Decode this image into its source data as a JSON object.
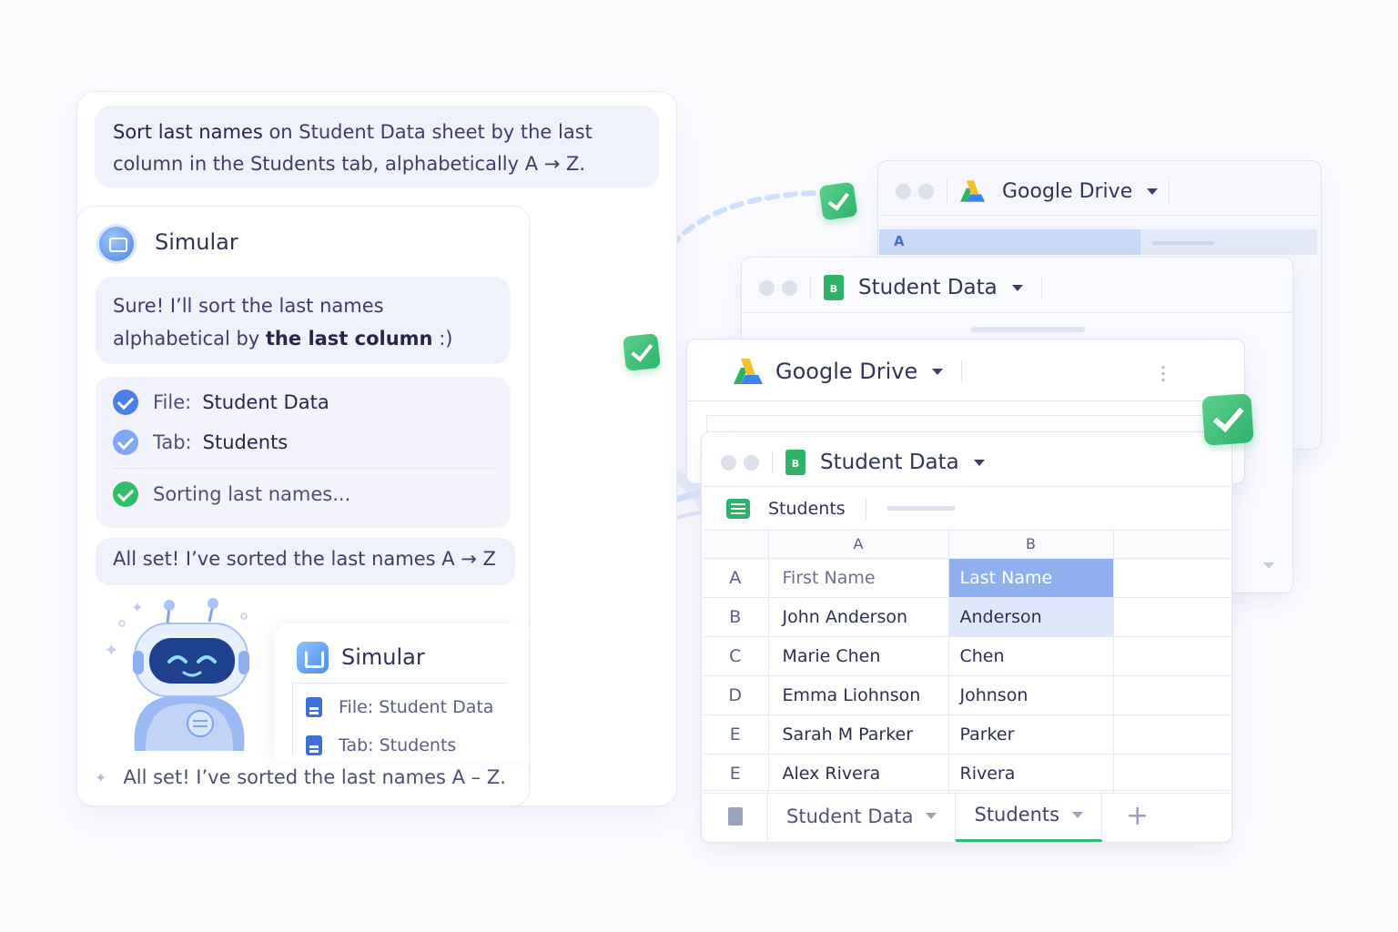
{
  "chat": {
    "prompt_bold": "Sort last names",
    "prompt_rest_1": " on Student Data sheet by the last",
    "prompt_line2": "column in the Students tab, alphabetically A → Z.",
    "agent_name": "Simular",
    "reply_line1_pre": "Sure! I’ll sort ",
    "reply_line1_bold": "the last names",
    "reply_line2_pre": "alphabetical by ",
    "reply_line2_mid": "the ",
    "reply_line2_bold": "last column",
    "reply_line2_post": " :)",
    "steps": [
      {
        "label": "File:",
        "value": "Student Data"
      },
      {
        "label": "Tab:",
        "value": "Students"
      },
      {
        "label": "Sorting last names...",
        "value": ""
      }
    ],
    "done_message": "All set! I’ve sorted the last names A → Z",
    "mini_card": {
      "name": "Simular",
      "file": "File: Student Data",
      "tab": "Tab: Students"
    },
    "footer_message": "All set! I’ve sorted the last names A – Z."
  },
  "windows": {
    "back_drive_title": "Google Drive",
    "back_col_label": "A",
    "back_sheet_title": "Student Data",
    "mid_drive_title": "Google Drive",
    "front_sheet_title": "Student Data",
    "front_sheet_badge": "B",
    "tab_name": "Students"
  },
  "sheet": {
    "col_headers": [
      "A",
      "B"
    ],
    "rows": [
      {
        "row": "A",
        "first": "First Name",
        "last": "Last Name"
      },
      {
        "row": "B",
        "first": "John Anderson",
        "last": "Anderson"
      },
      {
        "row": "C",
        "first": "Marie Chen",
        "last": "Chen"
      },
      {
        "row": "D",
        "first": "Emma Liohnson",
        "last": "Johnson"
      },
      {
        "row": "E",
        "first": "Sarah M Parker",
        "last": "Parker"
      },
      {
        "row": "E",
        "first": "Alex Rivera",
        "last": "Rivera"
      }
    ],
    "tabs": [
      "Student Data",
      "Students"
    ],
    "add_tab": "+"
  },
  "colors": {
    "accent_blue": "#4a7fea",
    "success_green": "#2fbf6b",
    "header_highlight": "#8fb0ee"
  },
  "icons": [
    "drive-icon",
    "sheets-icon",
    "check-icon",
    "robot-icon",
    "document-icon",
    "list-icon"
  ]
}
